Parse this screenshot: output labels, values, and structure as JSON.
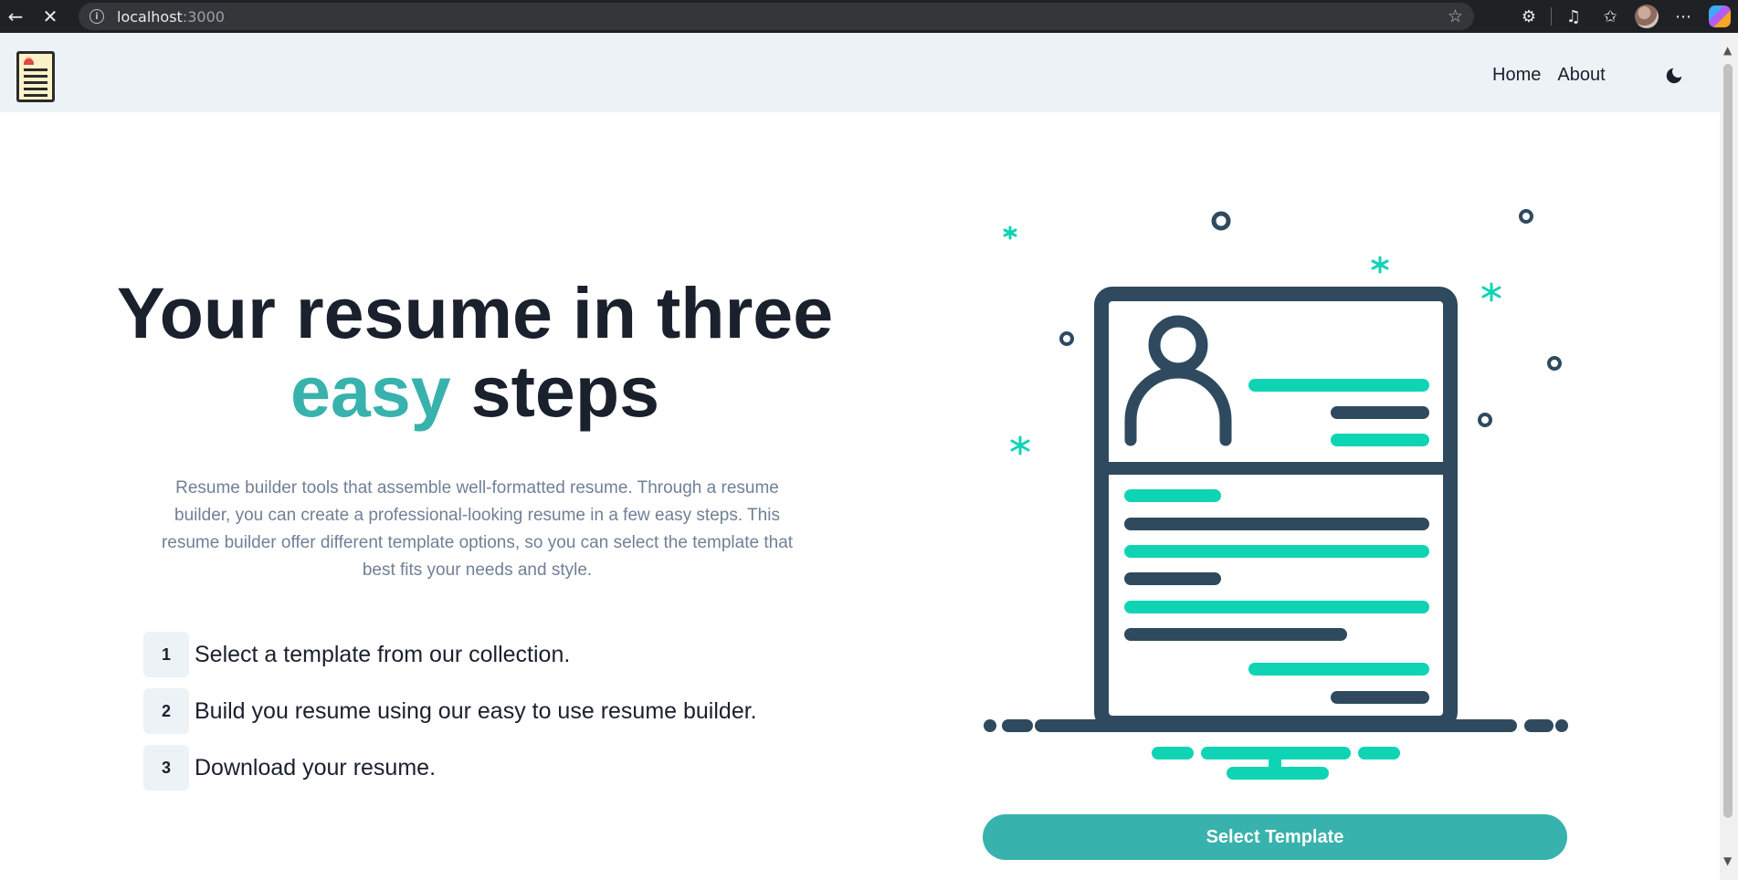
{
  "browser": {
    "url_host": "localhost",
    "url_port": ":3000",
    "back_icon": "back-arrow-icon",
    "stop_icon": "close-icon"
  },
  "header": {
    "nav": [
      {
        "label": "Home"
      },
      {
        "label": "About"
      }
    ],
    "theme_icon": "moon-icon"
  },
  "hero": {
    "title_line1": "Your resume in three",
    "title_accent": "easy",
    "title_rest": " steps",
    "description": "Resume builder tools that assemble well-formatted resume. Through a resume builder, you can create a professional-looking resume in a few easy steps. This resume builder offer different template options, so you can select the template that best fits your needs and style.",
    "steps": [
      {
        "num": "1",
        "text": "Select a template from our collection."
      },
      {
        "num": "2",
        "text": "Build you resume using our easy to use resume builder."
      },
      {
        "num": "3",
        "text": "Download your resume."
      }
    ],
    "cta_label": "Select Template"
  },
  "colors": {
    "accent": "#38b2ac",
    "illustration_teal": "#0fd4b4",
    "illustration_dark": "#2f4a5e",
    "header_bg": "#edf2f7",
    "text_dark": "#1a202c",
    "text_muted": "#718096"
  }
}
